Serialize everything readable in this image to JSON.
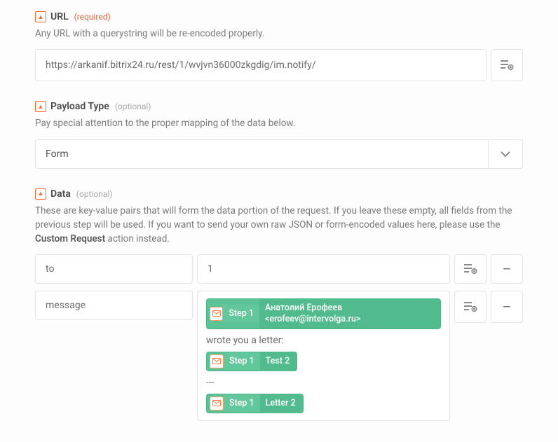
{
  "url": {
    "label": "URL",
    "req": "(required)",
    "help": "Any URL with a querystring will be re-encoded properly.",
    "value": "https://arkanif.bitrix24.ru/rest/1/wvjvn36000zkgdig/im.notify/"
  },
  "payload": {
    "label": "Payload Type",
    "opt": "(optional)",
    "help": "Pay special attention to the proper mapping of the data below.",
    "value": "Form"
  },
  "data": {
    "label": "Data",
    "opt": "(optional)",
    "help_pre": "These are key-value pairs that will form the data portion of the request. If you leave these empty, all fields from the previous step will be used. If you want to send your own raw JSON or form-encoded values here, please use the ",
    "help_strong": "Custom Request",
    "help_post": " action instead.",
    "rows": [
      {
        "key": "to",
        "simple_value": "1"
      },
      {
        "key": "message"
      }
    ],
    "message_parts": {
      "pill1_step": "Step 1",
      "pill1_val": "Анатолий Ерофеев <erofeev@intervolga.ru>",
      "line1": "wrote you a letter:",
      "pill2_step": "Step 1",
      "pill2_val": "Test 2",
      "line2": "---",
      "pill3_step": "Step 1",
      "pill3_val": "Letter 2"
    }
  },
  "icons": {
    "app_glyph": "▲",
    "minus": "–"
  }
}
